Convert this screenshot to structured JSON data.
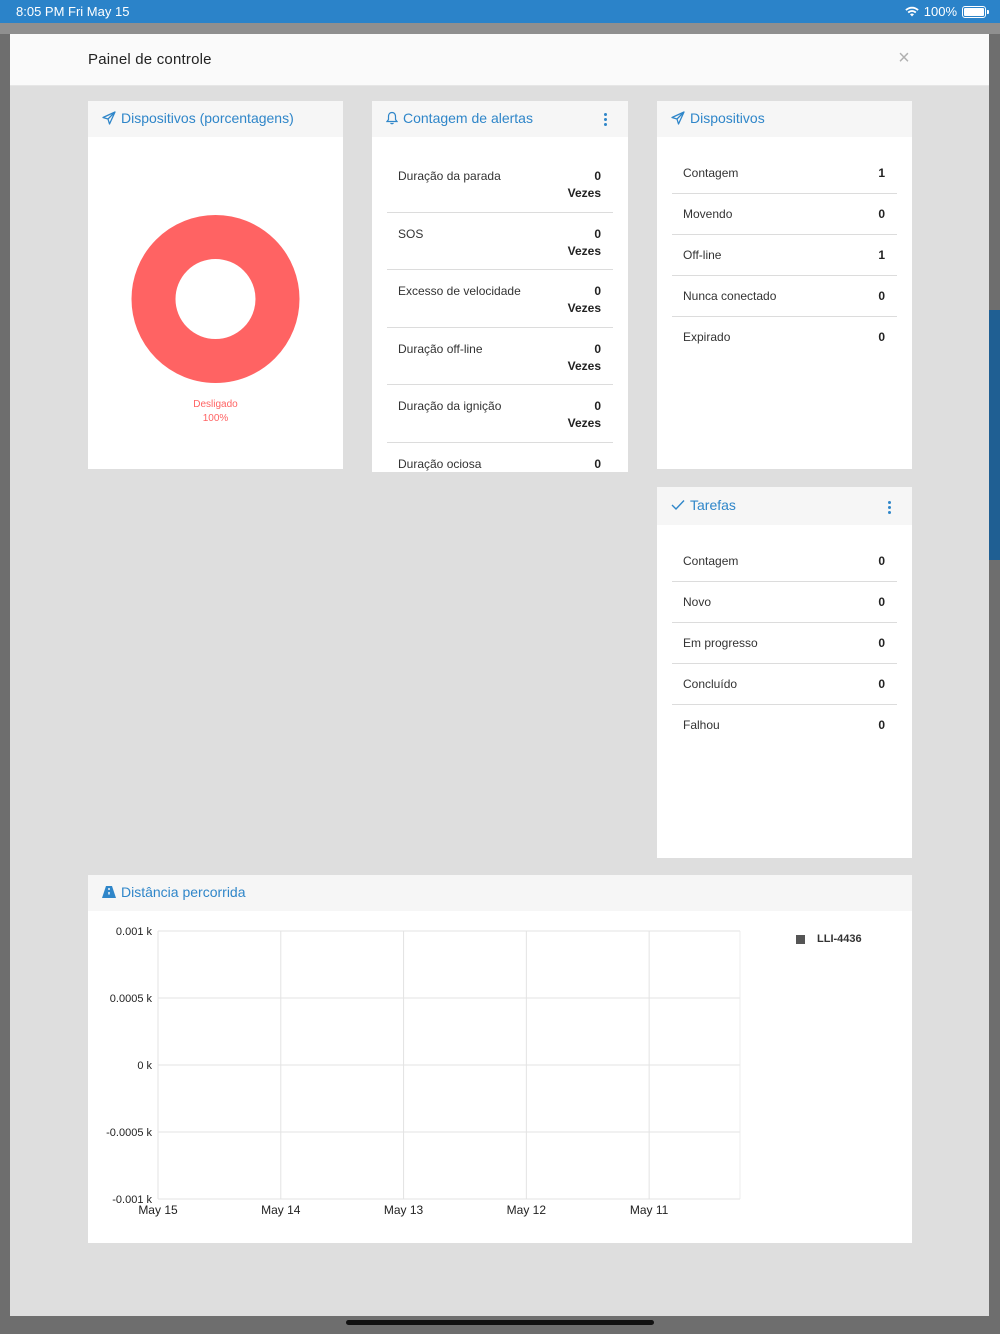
{
  "status_bar": {
    "time_date": "8:05 PM   Fri May 15",
    "battery": "100%"
  },
  "modal": {
    "title": "Painel de controle",
    "close_icon": "×"
  },
  "devices_pct": {
    "title": "Dispositivos (porcentagens)",
    "icon": "paper-plane-icon",
    "chart_data": {
      "type": "pie",
      "style": "donut",
      "slices": [
        {
          "label": "Desligado",
          "value": 100,
          "color": "#ff6363"
        }
      ]
    },
    "slice_label": "Desligado",
    "slice_pct": "100%"
  },
  "alerts": {
    "title": "Contagem de alertas",
    "icon": "bell-icon",
    "unit": "Vezes",
    "items": [
      {
        "label": "Duração da parada",
        "value": "0"
      },
      {
        "label": "SOS",
        "value": "0"
      },
      {
        "label": "Excesso de velocidade",
        "value": "0"
      },
      {
        "label": "Duração off-line",
        "value": "0"
      },
      {
        "label": "Duração da ignição",
        "value": "0"
      },
      {
        "label": "Duração ociosa",
        "value": "0"
      }
    ]
  },
  "devices": {
    "title": "Dispositivos",
    "icon": "paper-plane-icon",
    "items": [
      {
        "label": "Contagem",
        "value": "1"
      },
      {
        "label": "Movendo",
        "value": "0"
      },
      {
        "label": "Off-line",
        "value": "1"
      },
      {
        "label": "Nunca conectado",
        "value": "0"
      },
      {
        "label": "Expirado",
        "value": "0"
      }
    ]
  },
  "tasks": {
    "title": "Tarefas",
    "icon": "check-icon",
    "items": [
      {
        "label": "Contagem",
        "value": "0"
      },
      {
        "label": "Novo",
        "value": "0"
      },
      {
        "label": "Em progresso",
        "value": "0"
      },
      {
        "label": "Concluído",
        "value": "0"
      },
      {
        "label": "Falhou",
        "value": "0"
      }
    ]
  },
  "distance": {
    "title": "Distância percorrida",
    "icon": "road-icon",
    "chart_data": {
      "type": "line",
      "title": "",
      "xlabel": "",
      "ylabel": "",
      "categories": [
        "May 15",
        "May 14",
        "May 13",
        "May 12",
        "May 11"
      ],
      "y_ticks": [
        "0.001 k",
        "0.0005 k",
        "0 k",
        "-0.0005 k",
        "-0.001 k"
      ],
      "ylim": [
        -0.001,
        0.001
      ],
      "grid": true,
      "legend_position": "right",
      "series": [
        {
          "name": "LLI-4436",
          "values": [],
          "color": "#555555"
        }
      ]
    }
  }
}
